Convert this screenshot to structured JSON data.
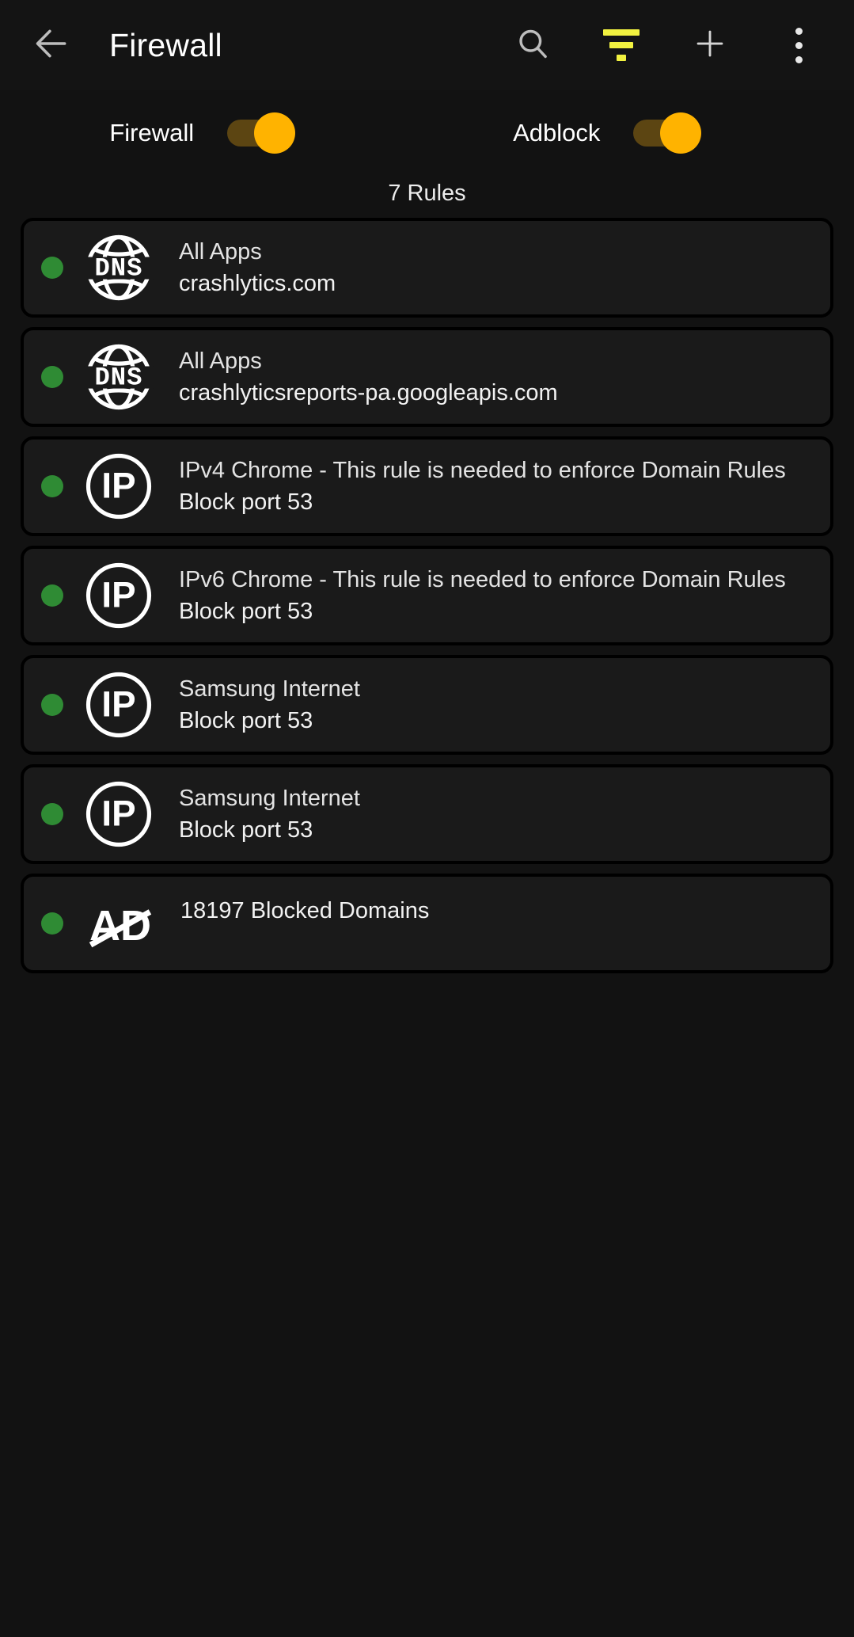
{
  "appbar": {
    "back_icon": "arrow-left-icon",
    "title": "Firewall",
    "actions": [
      {
        "name": "search-icon",
        "label": "Search"
      },
      {
        "name": "filter-icon",
        "label": "Filter",
        "color": "#f2f240"
      },
      {
        "name": "plus-icon",
        "label": "Add"
      },
      {
        "name": "overflow-menu-icon",
        "label": "More options"
      }
    ]
  },
  "toggles": [
    {
      "label": "Firewall",
      "state": "on",
      "track_color": "#5c4512",
      "thumb_color": "#ffb300"
    },
    {
      "label": "Adblock",
      "state": "on",
      "track_color": "#5c4512",
      "thumb_color": "#ffb300"
    }
  ],
  "rules_count_label": "7 Rules",
  "status_color": "#2f8b34",
  "rules": [
    {
      "icon": "dns-globe-icon",
      "icon_text": "DNS",
      "title": "All Apps",
      "subtitle": "crashlytics.com",
      "status": "enabled"
    },
    {
      "icon": "dns-globe-icon",
      "icon_text": "DNS",
      "title": "All Apps",
      "subtitle": "crashlyticsreports-pa.googleapis.com",
      "status": "enabled"
    },
    {
      "icon": "ip-circle-icon",
      "icon_text": "IP",
      "title": "IPv4 Chrome - This rule is needed to enforce Domain Rules",
      "subtitle": "Block port 53",
      "status": "enabled"
    },
    {
      "icon": "ip-circle-icon",
      "icon_text": "IP",
      "title": "IPv6 Chrome - This rule is needed to enforce Domain Rules",
      "subtitle": "Block port 53",
      "status": "enabled"
    },
    {
      "icon": "ip-circle-icon",
      "icon_text": "IP",
      "title": "Samsung Internet",
      "subtitle": "Block port 53",
      "status": "enabled"
    },
    {
      "icon": "ip-circle-icon",
      "icon_text": "IP",
      "title": "Samsung Internet",
      "subtitle": "Block port 53",
      "status": "enabled"
    },
    {
      "icon": "ad-blocked-icon",
      "icon_text": "AD",
      "title": "18197 Blocked Domains",
      "subtitle": "",
      "status": "enabled"
    }
  ]
}
